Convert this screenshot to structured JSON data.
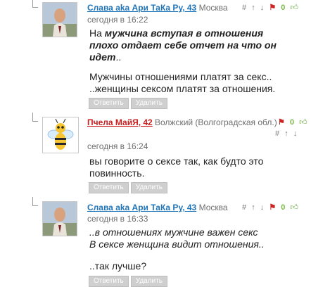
{
  "comments": [
    {
      "author": "Слава aka Ари ТаКа Ру, 43",
      "city": "Москва",
      "date": "сегодня в 16:22",
      "hash": "#",
      "up": "↑",
      "down": "↓",
      "count": "0",
      "text_part1": "На ",
      "text_bold": "мужчина вступая в отношения плохо отдает себе отчет на что он идет",
      "text_part2": "..",
      "text_line2": "Мужчины отношениями платят за секс..",
      "text_line3": "..женщины сексом платят за отношения.",
      "reply": "Ответить",
      "delete": "Удалить"
    },
    {
      "author": "Пчела МайЯ, 42",
      "city": "Волжский (Волгоградская обл.)",
      "date": "сегодня в 16:24",
      "hash": "#",
      "up": "↑",
      "down": "↓",
      "count": "0",
      "text_line1": "вы говорите о сексе так, как будто это",
      "text_line2": "повинность.",
      "reply": "Ответить",
      "delete": "Удалить"
    },
    {
      "author": "Слава aka Ари ТаКа Ру, 43",
      "city": "Москва",
      "date": "сегодня в 16:33",
      "hash": "#",
      "up": "↑",
      "down": "↓",
      "count": "0",
      "text_line1": "..в отношениях мужчине важен секс",
      "text_line2": "В сексе женщина видит отношения..",
      "text_line3": "..так лучше?",
      "reply": "Ответить",
      "delete": "Удалить"
    }
  ],
  "colors": {
    "link_blue": "#1f74b8",
    "link_red": "#cc1e1e",
    "flag_red": "#cc2222",
    "like_green": "#7ab648"
  },
  "icons": [
    "flag-icon",
    "thumb-up-icon",
    "man-photo-avatar",
    "bee-avatar"
  ]
}
